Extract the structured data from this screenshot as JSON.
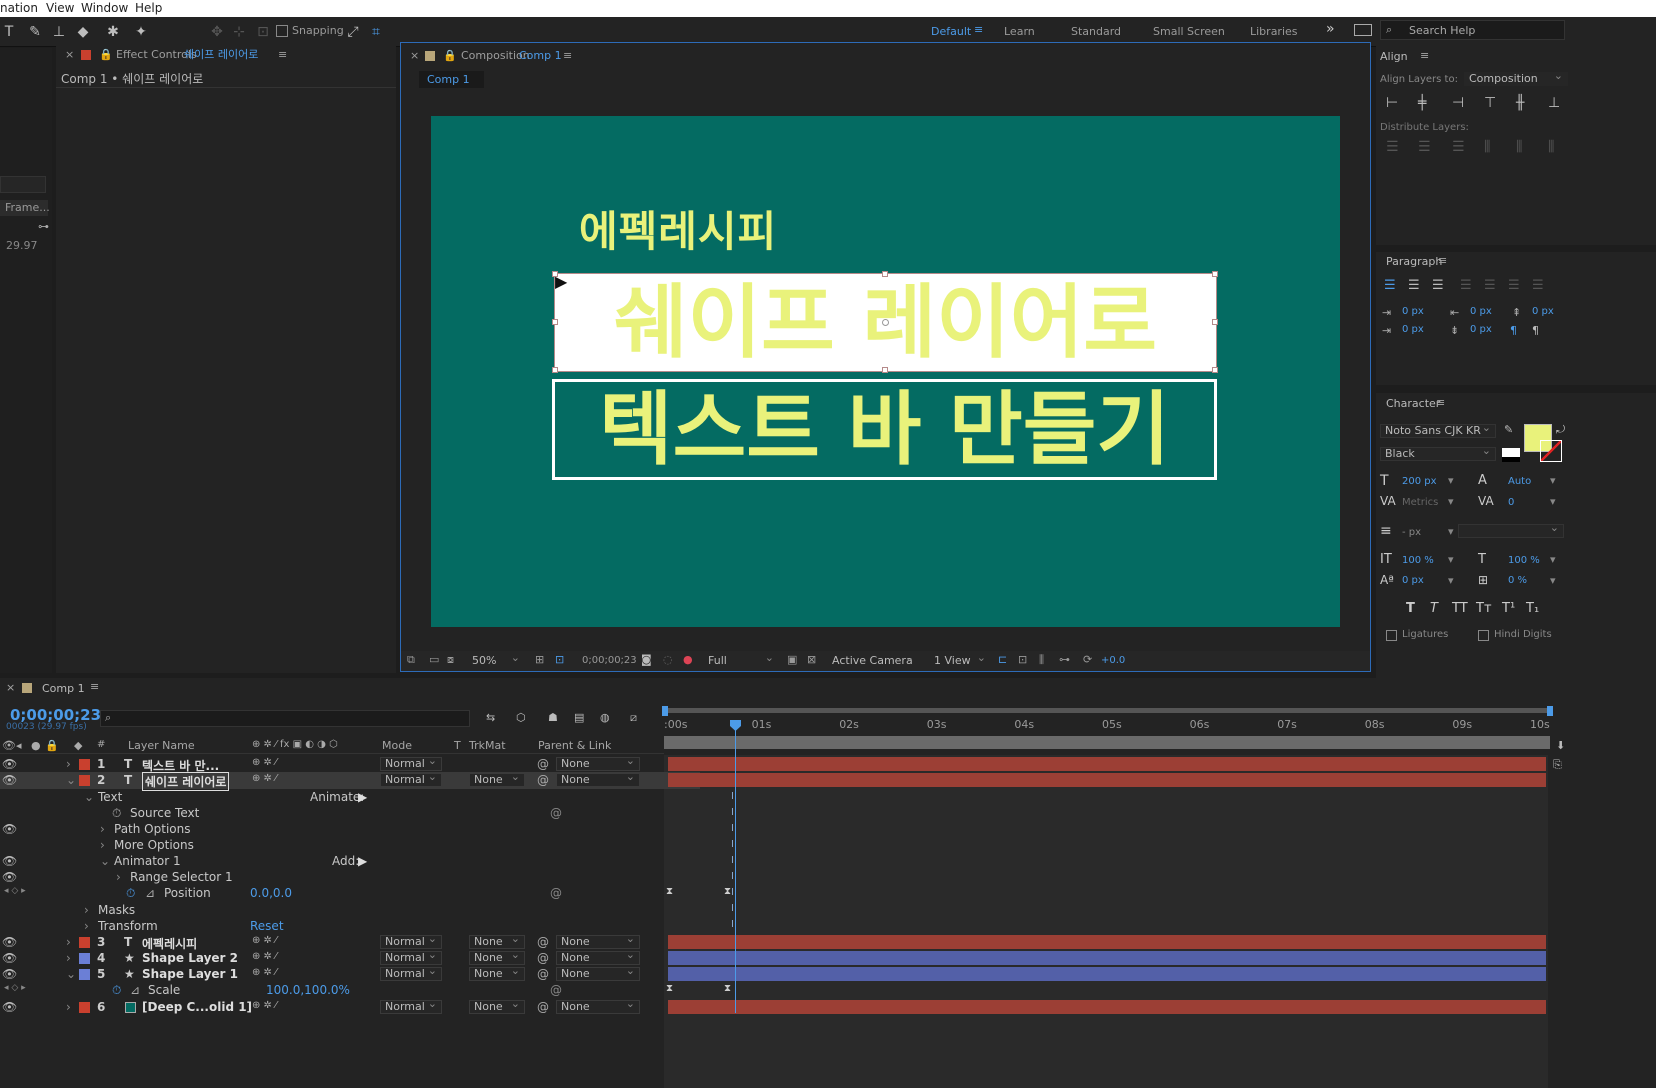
{
  "menu": [
    "nation",
    "View",
    "Window",
    "Help"
  ],
  "toolbar": {
    "snapping_label": "Snapping"
  },
  "workspaces": [
    "Default",
    "Learn",
    "Standard",
    "Small Screen",
    "Libraries"
  ],
  "search_help": "Search Help",
  "left_strip": {
    "frame_label": "Frame...",
    "fps": "29.97"
  },
  "effect_controls": {
    "title": "Effect Controls",
    "layer_name": "쉐이프 레이어로",
    "breadcrumb": "Comp 1 • 쉐이프 레이어로"
  },
  "composition": {
    "title": "Composition",
    "comp_name": "Comp 1",
    "tab": "Comp 1",
    "canvas_text": {
      "line1": "에펙레시피",
      "line2": "쉐이프 레이어로",
      "line3": "텍스트 바 만들기"
    },
    "colors": {
      "bg": "#046b62",
      "text": "#e9f27b",
      "box": "#ffffff"
    },
    "footer": {
      "zoom": "50%",
      "timecode": "0;00;00;23",
      "resolution": "Full",
      "camera": "Active Camera",
      "view": "1 View",
      "exposure": "+0.0"
    }
  },
  "align": {
    "title": "Align",
    "align_to_label": "Align Layers to:",
    "align_to_value": "Composition",
    "distribute_label": "Distribute Layers:"
  },
  "paragraph": {
    "title": "Paragraph",
    "fields": [
      "0 px",
      "0 px",
      "0 px",
      "0 px",
      "0 px"
    ]
  },
  "character": {
    "title": "Character",
    "font": "Noto Sans CJK KR",
    "style": "Black",
    "size": "200 px",
    "leading": "Auto",
    "kerning": "Metrics",
    "tracking": "0",
    "stroke": "- px",
    "vscale": "100 %",
    "hscale": "100 %",
    "baseline": "0 px",
    "tsume": "0 %",
    "ligatures": "Ligatures",
    "hindi": "Hindi Digits",
    "fill_color": "#e9f27b"
  },
  "timeline": {
    "tab": "Comp 1",
    "timecode": "0;00;00;23",
    "fps_sub": "00023 (29.97 fps)",
    "headers": {
      "layer_name": "Layer Name",
      "mode": "Mode",
      "t": "T",
      "trkmat": "TrkMat",
      "parent": "Parent & Link",
      "num": "#"
    },
    "ruler": [
      ":00s",
      "01s",
      "02s",
      "03s",
      "04s",
      "05s",
      "06s",
      "07s",
      "08s",
      "09s",
      "10s"
    ],
    "layers": [
      {
        "num": "1",
        "name": "텍스트 바 만...",
        "mode": "Normal",
        "trk": "",
        "parent": "None",
        "color": "#c9402e"
      },
      {
        "num": "2",
        "name": "쉐이프 레이어로",
        "mode": "Normal",
        "trk": "None",
        "parent": "None",
        "color": "#c9402e"
      },
      {
        "num": "3",
        "name": "에펙레시피",
        "mode": "Normal",
        "trk": "None",
        "parent": "None",
        "color": "#c9402e"
      },
      {
        "num": "4",
        "name": "Shape Layer 2",
        "mode": "Normal",
        "trk": "None",
        "parent": "None",
        "color": "#6b7fd6"
      },
      {
        "num": "5",
        "name": "Shape Layer 1",
        "mode": "Normal",
        "trk": "None",
        "parent": "None",
        "color": "#6b7fd6"
      },
      {
        "num": "6",
        "name": "[Deep C...olid 1]",
        "mode": "Normal",
        "trk": "None",
        "parent": "None",
        "color": "#c9402e"
      }
    ],
    "props": {
      "text": "Text",
      "animate": "Animate:",
      "source_text": "Source Text",
      "path_options": "Path Options",
      "more_options": "More Options",
      "animator": "Animator 1",
      "add": "Add:",
      "range_selector": "Range Selector 1",
      "position": "Position",
      "position_value": "0.0,0.0",
      "masks": "Masks",
      "transform": "Transform",
      "reset": "Reset",
      "scale": "Scale",
      "scale_value": "100.0,100.0%"
    }
  }
}
